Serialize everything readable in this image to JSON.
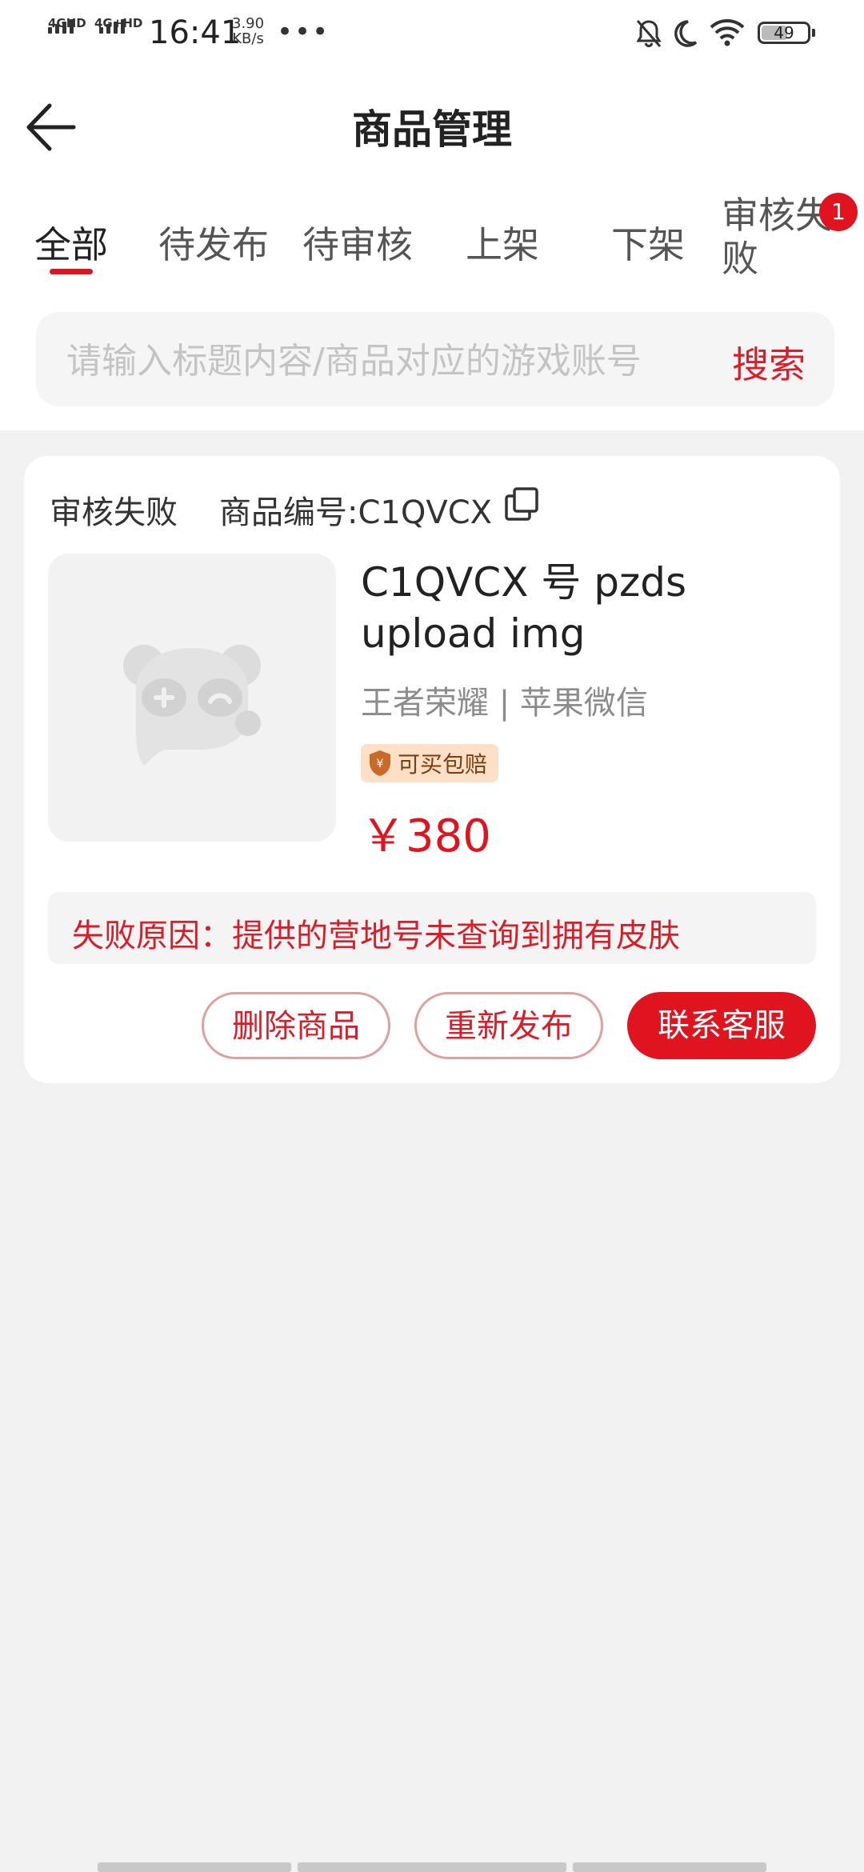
{
  "status_bar": {
    "sim1": "4GHD",
    "sim2": "4G+HD",
    "time": "16:41",
    "speed_value": "3.90",
    "speed_unit": "KB/s",
    "more": "•••",
    "battery": "49"
  },
  "header": {
    "title": "商品管理"
  },
  "tabs": [
    {
      "label": "全部",
      "active": true
    },
    {
      "label": "待发布",
      "active": false
    },
    {
      "label": "待审核",
      "active": false
    },
    {
      "label": "上架",
      "active": false
    },
    {
      "label": "下架",
      "active": false
    },
    {
      "label": "审核失",
      "label_line2": "败",
      "badge": "1",
      "active": false
    }
  ],
  "search": {
    "placeholder": "请输入标题内容/商品对应的游戏账号",
    "button": "搜索"
  },
  "colors": {
    "accent": "#e0141e",
    "background": "#f2f2f2",
    "card": "#ffffff",
    "muted_text": "#8c8c8c"
  },
  "products": [
    {
      "status": "审核失败",
      "code_label": "商品编号:C1QVCX",
      "title": "C1QVCX 号 pzds upload img",
      "game": "王者荣耀 | 苹果微信",
      "guarantee": "可买包赔",
      "price": "￥380",
      "fail_reason": "失败原因：提供的营地号未查询到拥有皮肤",
      "actions": {
        "delete": "删除商品",
        "republish": "重新发布",
        "contact": "联系客服"
      },
      "thumbnail_icon": "panda-placeholder-icon"
    }
  ]
}
